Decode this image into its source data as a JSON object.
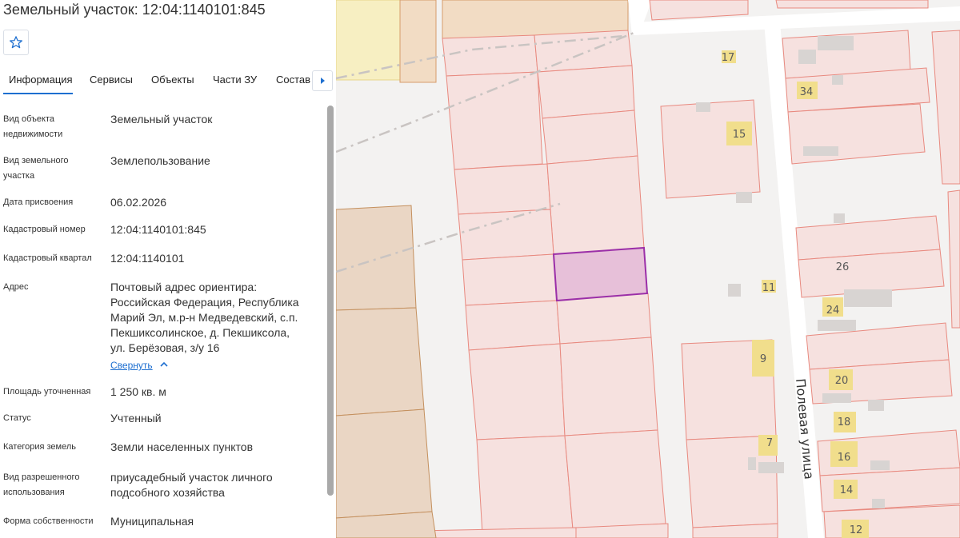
{
  "header": {
    "title": "Земельный участок: 12:04:1140101:845"
  },
  "tabs": [
    {
      "label": "Информация"
    },
    {
      "label": "Сервисы"
    },
    {
      "label": "Объекты"
    },
    {
      "label": "Части ЗУ"
    },
    {
      "label": "Состав"
    }
  ],
  "info": {
    "object_type": {
      "label_1": "Вид объекта",
      "label_2": "недвижимости",
      "value": "Земельный участок"
    },
    "parcel_type": {
      "label_1": "Вид земельного",
      "label_2": "участка",
      "value": "Землепользование"
    },
    "date": {
      "label": "Дата присвоения",
      "value": "06.02.2026"
    },
    "cadastral_number": {
      "label": "Кадастровый номер",
      "value": "12:04:1140101:845"
    },
    "cadastral_quarter": {
      "label": "Кадастровый квартал",
      "value": "12:04:1140101"
    },
    "address": {
      "label": "Адрес",
      "lines": [
        "Почтовый адрес ориентира:",
        "Российская Федерация, Республика",
        "Марий Эл, м.р-н Медведевский, с.п.",
        "Пекшиксолинское, д. Пекшиксола,",
        "ул. Берёзовая, з/у 16"
      ],
      "collapse": "Свернуть"
    },
    "area": {
      "label": "Площадь уточненная",
      "value": "1 250 кв. м"
    },
    "status": {
      "label": "Статус",
      "value": "Учтенный"
    },
    "category": {
      "label": "Категория земель",
      "value": "Земли населенных пунктов"
    },
    "permitted_use": {
      "label_1": "Вид разрешенного",
      "label_2": "использования",
      "value_1": "приусадебный участок личного",
      "value_2": "подсобного хозяйства"
    },
    "ownership": {
      "label": "Форма собственности",
      "value": "Муниципальная"
    }
  },
  "map": {
    "street": "Полевая улица",
    "house_numbers": [
      "17",
      "34",
      "15",
      "26",
      "11",
      "24",
      "9",
      "20",
      "18",
      "7",
      "16",
      "14",
      "12"
    ],
    "colors": {
      "parcel_fill": "#f6e1df",
      "parcel_stroke": "#e8897f",
      "selected_fill": "#e7c0d9",
      "selected_stroke": "#9b2fa8",
      "brown_fill": "#ead6c4",
      "brown_stroke": "#c4905e",
      "building": "#f1de8c",
      "road": "#ffffff"
    }
  }
}
